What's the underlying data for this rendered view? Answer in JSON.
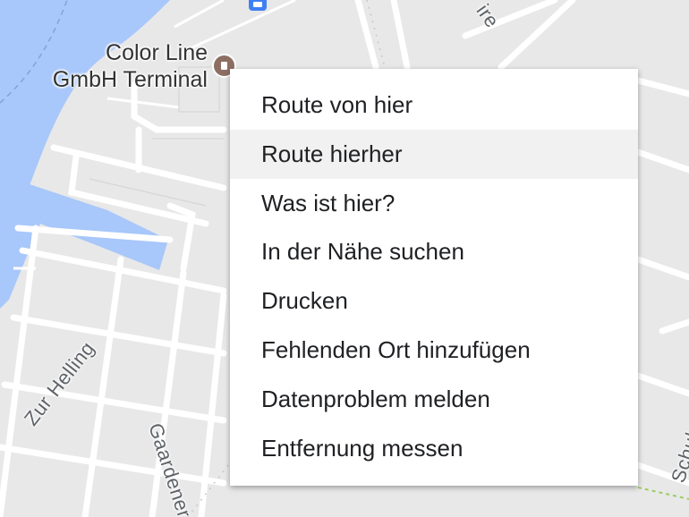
{
  "map": {
    "poi": {
      "label_line1": "Color Line",
      "label_line2": "GmbH Terminal",
      "marker_icon": "terminal-pin-icon",
      "marker_color": "#8d6e63"
    },
    "streets": {
      "zur_helling": "Zur Helling",
      "gaardener": "Gaardener",
      "schulstr": "Schulst",
      "partial_top": "ire"
    },
    "transit_icon": "bus-stop-icon",
    "colors": {
      "water": "#a8c7fa",
      "land": "#e8e8e8",
      "road": "#ffffff"
    }
  },
  "context_menu": {
    "items": [
      {
        "label": "Route von hier"
      },
      {
        "label": "Route hierher"
      },
      {
        "label": "Was ist hier?"
      },
      {
        "label": "In der Nähe suchen"
      },
      {
        "label": "Drucken"
      },
      {
        "label": "Fehlenden Ort hinzufügen"
      },
      {
        "label": "Datenproblem melden"
      },
      {
        "label": "Entfernung messen"
      }
    ]
  }
}
